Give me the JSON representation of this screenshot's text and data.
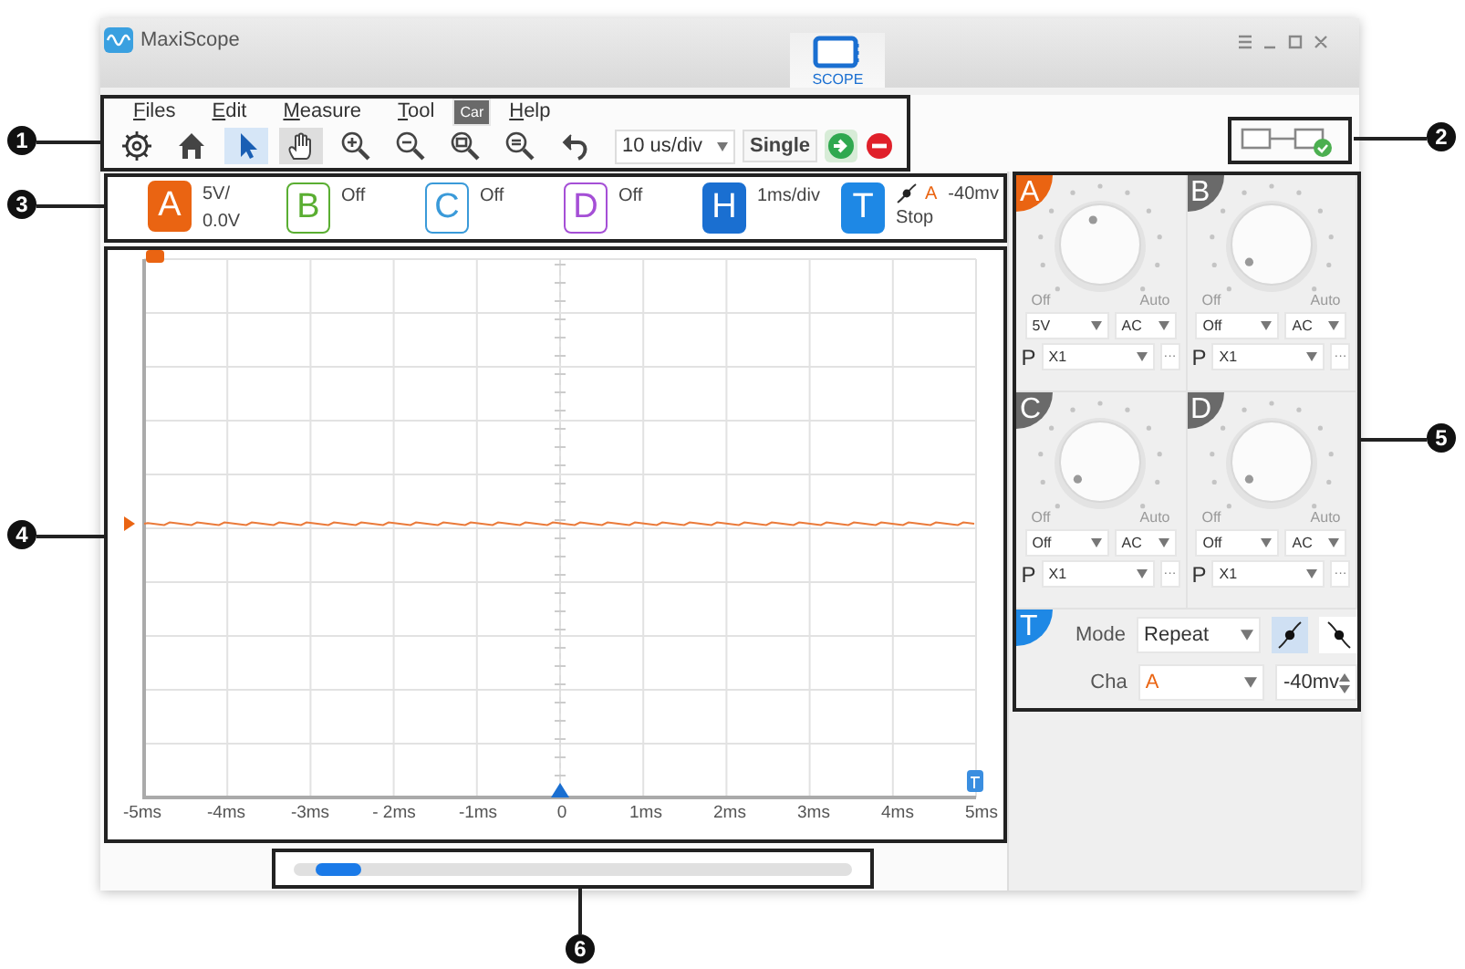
{
  "window": {
    "title": "MaxiScope",
    "tabs": [
      {
        "label": "SCOPE",
        "selected": true
      }
    ]
  },
  "menu": [
    {
      "label": "Files",
      "selected": false
    },
    {
      "label": "Edit",
      "selected": false
    },
    {
      "label": "Measure",
      "selected": false
    },
    {
      "label": "Tool",
      "selected": false
    },
    {
      "label": "Car",
      "selected": true
    },
    {
      "label": "Help",
      "selected": false
    }
  ],
  "tools": [
    {
      "kind": "settings",
      "selected": false,
      "hovered": false
    },
    {
      "kind": "home",
      "selected": false,
      "hovered": false
    },
    {
      "kind": "pointer",
      "selected": true,
      "hovered": false
    },
    {
      "kind": "hand",
      "selected": false,
      "hovered": true
    },
    {
      "kind": "zoom-in",
      "selected": false,
      "hovered": false
    },
    {
      "kind": "zoom-out",
      "selected": false,
      "hovered": false
    },
    {
      "kind": "zoom-box",
      "selected": false,
      "hovered": false
    },
    {
      "kind": "zoom-fit",
      "selected": false,
      "hovered": false
    },
    {
      "kind": "undo",
      "selected": false,
      "hovered": false
    }
  ],
  "timebase": {
    "value": "10 us/div"
  },
  "single_button": {
    "label": "Single"
  },
  "channel_bar": [
    {
      "letter": "A",
      "color": "#ea6412",
      "on": true,
      "lines": [
        "5V/",
        "0.0V"
      ]
    },
    {
      "letter": "B",
      "color": "#5aae32",
      "on": false,
      "lines": [
        "Off"
      ]
    },
    {
      "letter": "C",
      "color": "#3a9ad9",
      "on": false,
      "lines": [
        "Off"
      ]
    },
    {
      "letter": "D",
      "color": "#a54fd6",
      "on": false,
      "lines": [
        "Off"
      ]
    },
    {
      "letter": "H",
      "color": "#1a6fd1",
      "on": true,
      "lines": [
        "1ms/div"
      ]
    }
  ],
  "trigger_bar": {
    "letter": "T",
    "color": "#1e88e5",
    "channel": "A",
    "threshold": "-40mv",
    "status": "Stop"
  },
  "plot": {
    "x_labels": [
      "-5ms",
      "-4ms",
      "-3ms",
      "- 2ms",
      "-1ms",
      "0",
      "1ms",
      "2ms",
      "3ms",
      "4ms",
      "5ms"
    ]
  },
  "channel_panels": [
    {
      "letter": "A",
      "on": true,
      "off_label": "Off",
      "auto_label": "Auto",
      "range": "5V",
      "coupling": "AC",
      "probe_label": "P",
      "probe": "X1",
      "more": "···"
    },
    {
      "letter": "B",
      "on": false,
      "off_label": "Off",
      "auto_label": "Auto",
      "range": "Off",
      "coupling": "AC",
      "probe_label": "P",
      "probe": "X1",
      "more": "···"
    },
    {
      "letter": "C",
      "on": false,
      "off_label": "Off",
      "auto_label": "Auto",
      "range": "Off",
      "coupling": "AC",
      "probe_label": "P",
      "probe": "X1",
      "more": "···"
    },
    {
      "letter": "D",
      "on": false,
      "off_label": "Off",
      "auto_label": "Auto",
      "range": "Off",
      "coupling": "AC",
      "probe_label": "P",
      "probe": "X1",
      "more": "···"
    }
  ],
  "trigger_panel": {
    "letter": "T",
    "mode_label": "Mode",
    "mode": "Repeat",
    "edges": [
      {
        "kind": "rising",
        "selected": true
      },
      {
        "kind": "falling",
        "selected": false
      }
    ],
    "channel_label": "Cha",
    "channel": "A",
    "threshold": "-40mv"
  },
  "callouts": [
    "1",
    "2",
    "3",
    "4",
    "5",
    "6"
  ]
}
